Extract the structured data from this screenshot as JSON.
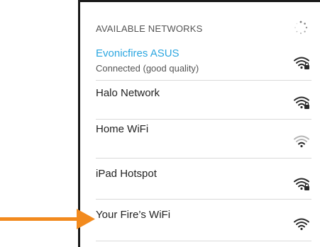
{
  "section": {
    "title": "AVAILABLE NETWORKS",
    "spinner_icon": "loading-spinner-icon"
  },
  "networks": [
    {
      "name": "Evonicfires ASUS",
      "status": "Connected (good quality)",
      "connected": true,
      "secured": true,
      "signal": "full",
      "icon": "wifi-locked-icon"
    },
    {
      "name": "Halo Network",
      "status": "",
      "connected": false,
      "secured": true,
      "signal": "full",
      "icon": "wifi-locked-icon"
    },
    {
      "name": "Home WiFi",
      "status": "",
      "connected": false,
      "secured": false,
      "signal": "weak",
      "icon": "wifi-weak-icon"
    },
    {
      "name": "iPad Hotspot",
      "status": "",
      "connected": false,
      "secured": true,
      "signal": "full",
      "icon": "wifi-locked-icon"
    },
    {
      "name": "Your Fire’s WiFi",
      "status": "",
      "connected": false,
      "secured": false,
      "signal": "full",
      "icon": "wifi-open-icon"
    }
  ],
  "annotation": {
    "icon": "orange-arrow-icon",
    "color": "#f28a1e"
  },
  "colors": {
    "accent": "#2ba6e0",
    "border": "#1a1a1a",
    "text": "#222222",
    "secondary": "#555555"
  }
}
